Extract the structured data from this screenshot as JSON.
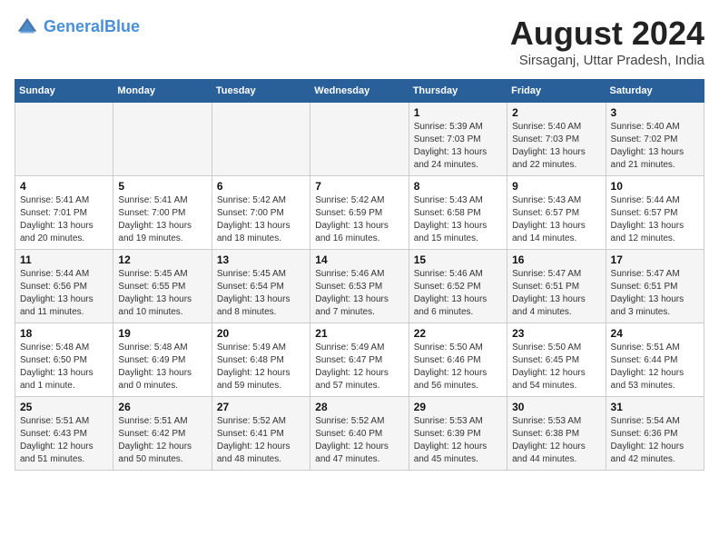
{
  "header": {
    "logo_line1": "General",
    "logo_line2": "Blue",
    "month": "August 2024",
    "location": "Sirsaganj, Uttar Pradesh, India"
  },
  "weekdays": [
    "Sunday",
    "Monday",
    "Tuesday",
    "Wednesday",
    "Thursday",
    "Friday",
    "Saturday"
  ],
  "weeks": [
    [
      {
        "day": "",
        "info": ""
      },
      {
        "day": "",
        "info": ""
      },
      {
        "day": "",
        "info": ""
      },
      {
        "day": "",
        "info": ""
      },
      {
        "day": "1",
        "info": "Sunrise: 5:39 AM\nSunset: 7:03 PM\nDaylight: 13 hours and 24 minutes."
      },
      {
        "day": "2",
        "info": "Sunrise: 5:40 AM\nSunset: 7:03 PM\nDaylight: 13 hours and 22 minutes."
      },
      {
        "day": "3",
        "info": "Sunrise: 5:40 AM\nSunset: 7:02 PM\nDaylight: 13 hours and 21 minutes."
      }
    ],
    [
      {
        "day": "4",
        "info": "Sunrise: 5:41 AM\nSunset: 7:01 PM\nDaylight: 13 hours and 20 minutes."
      },
      {
        "day": "5",
        "info": "Sunrise: 5:41 AM\nSunset: 7:00 PM\nDaylight: 13 hours and 19 minutes."
      },
      {
        "day": "6",
        "info": "Sunrise: 5:42 AM\nSunset: 7:00 PM\nDaylight: 13 hours and 18 minutes."
      },
      {
        "day": "7",
        "info": "Sunrise: 5:42 AM\nSunset: 6:59 PM\nDaylight: 13 hours and 16 minutes."
      },
      {
        "day": "8",
        "info": "Sunrise: 5:43 AM\nSunset: 6:58 PM\nDaylight: 13 hours and 15 minutes."
      },
      {
        "day": "9",
        "info": "Sunrise: 5:43 AM\nSunset: 6:57 PM\nDaylight: 13 hours and 14 minutes."
      },
      {
        "day": "10",
        "info": "Sunrise: 5:44 AM\nSunset: 6:57 PM\nDaylight: 13 hours and 12 minutes."
      }
    ],
    [
      {
        "day": "11",
        "info": "Sunrise: 5:44 AM\nSunset: 6:56 PM\nDaylight: 13 hours and 11 minutes."
      },
      {
        "day": "12",
        "info": "Sunrise: 5:45 AM\nSunset: 6:55 PM\nDaylight: 13 hours and 10 minutes."
      },
      {
        "day": "13",
        "info": "Sunrise: 5:45 AM\nSunset: 6:54 PM\nDaylight: 13 hours and 8 minutes."
      },
      {
        "day": "14",
        "info": "Sunrise: 5:46 AM\nSunset: 6:53 PM\nDaylight: 13 hours and 7 minutes."
      },
      {
        "day": "15",
        "info": "Sunrise: 5:46 AM\nSunset: 6:52 PM\nDaylight: 13 hours and 6 minutes."
      },
      {
        "day": "16",
        "info": "Sunrise: 5:47 AM\nSunset: 6:51 PM\nDaylight: 13 hours and 4 minutes."
      },
      {
        "day": "17",
        "info": "Sunrise: 5:47 AM\nSunset: 6:51 PM\nDaylight: 13 hours and 3 minutes."
      }
    ],
    [
      {
        "day": "18",
        "info": "Sunrise: 5:48 AM\nSunset: 6:50 PM\nDaylight: 13 hours and 1 minute."
      },
      {
        "day": "19",
        "info": "Sunrise: 5:48 AM\nSunset: 6:49 PM\nDaylight: 13 hours and 0 minutes."
      },
      {
        "day": "20",
        "info": "Sunrise: 5:49 AM\nSunset: 6:48 PM\nDaylight: 12 hours and 59 minutes."
      },
      {
        "day": "21",
        "info": "Sunrise: 5:49 AM\nSunset: 6:47 PM\nDaylight: 12 hours and 57 minutes."
      },
      {
        "day": "22",
        "info": "Sunrise: 5:50 AM\nSunset: 6:46 PM\nDaylight: 12 hours and 56 minutes."
      },
      {
        "day": "23",
        "info": "Sunrise: 5:50 AM\nSunset: 6:45 PM\nDaylight: 12 hours and 54 minutes."
      },
      {
        "day": "24",
        "info": "Sunrise: 5:51 AM\nSunset: 6:44 PM\nDaylight: 12 hours and 53 minutes."
      }
    ],
    [
      {
        "day": "25",
        "info": "Sunrise: 5:51 AM\nSunset: 6:43 PM\nDaylight: 12 hours and 51 minutes."
      },
      {
        "day": "26",
        "info": "Sunrise: 5:51 AM\nSunset: 6:42 PM\nDaylight: 12 hours and 50 minutes."
      },
      {
        "day": "27",
        "info": "Sunrise: 5:52 AM\nSunset: 6:41 PM\nDaylight: 12 hours and 48 minutes."
      },
      {
        "day": "28",
        "info": "Sunrise: 5:52 AM\nSunset: 6:40 PM\nDaylight: 12 hours and 47 minutes."
      },
      {
        "day": "29",
        "info": "Sunrise: 5:53 AM\nSunset: 6:39 PM\nDaylight: 12 hours and 45 minutes."
      },
      {
        "day": "30",
        "info": "Sunrise: 5:53 AM\nSunset: 6:38 PM\nDaylight: 12 hours and 44 minutes."
      },
      {
        "day": "31",
        "info": "Sunrise: 5:54 AM\nSunset: 6:36 PM\nDaylight: 12 hours and 42 minutes."
      }
    ]
  ]
}
